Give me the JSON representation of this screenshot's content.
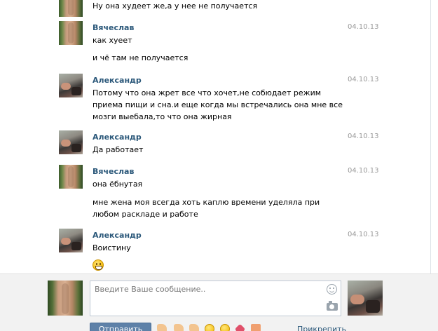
{
  "messages": [
    {
      "author": "",
      "date": "",
      "avatar": "vyacheslav",
      "lines": [
        "Ну она худеет же,а у нее не получается"
      ]
    },
    {
      "author": "Вячеслав",
      "date": "04.10.13",
      "avatar": "vyacheslav",
      "lines": [
        "как хуеет"
      ]
    },
    {
      "author": "",
      "date": "",
      "avatar": "",
      "lines": [
        "и чё там не получается"
      ]
    },
    {
      "author": "Александр",
      "date": "04.10.13",
      "avatar": "alexander",
      "lines": [
        "Потому что она жрет все что хочет,не собюдает режим приема пищи и сна.и еще когда мы встречались она мне все мозги выебала,то что она жирная"
      ]
    },
    {
      "author": "Александр",
      "date": "04.10.13",
      "avatar": "alexander",
      "lines": [
        "Да работает"
      ]
    },
    {
      "author": "Вячеслав",
      "date": "04.10.13",
      "avatar": "vyacheslav",
      "lines": [
        "она ёбнутая"
      ]
    },
    {
      "author": "",
      "date": "",
      "avatar": "",
      "lines": [
        "мне жена моя всегда хоть каплю времени уделяла при любом раскладе и работе"
      ]
    },
    {
      "author": "Александр",
      "date": "04.10.13",
      "avatar": "alexander",
      "lines": [
        "Воистину"
      ]
    }
  ],
  "composer": {
    "placeholder": "Введите Ваше сообщение..",
    "send_label": "Отправить",
    "attach_label": "Прикрепить"
  },
  "icons": {
    "smile": "smile-icon",
    "camera": "camera-icon",
    "emoji": "grinning-face-emoji"
  },
  "colors": {
    "author": "#2b587a",
    "date": "#999999",
    "send_button": "#5e81a8",
    "composer_bg": "#f2f2f2"
  }
}
